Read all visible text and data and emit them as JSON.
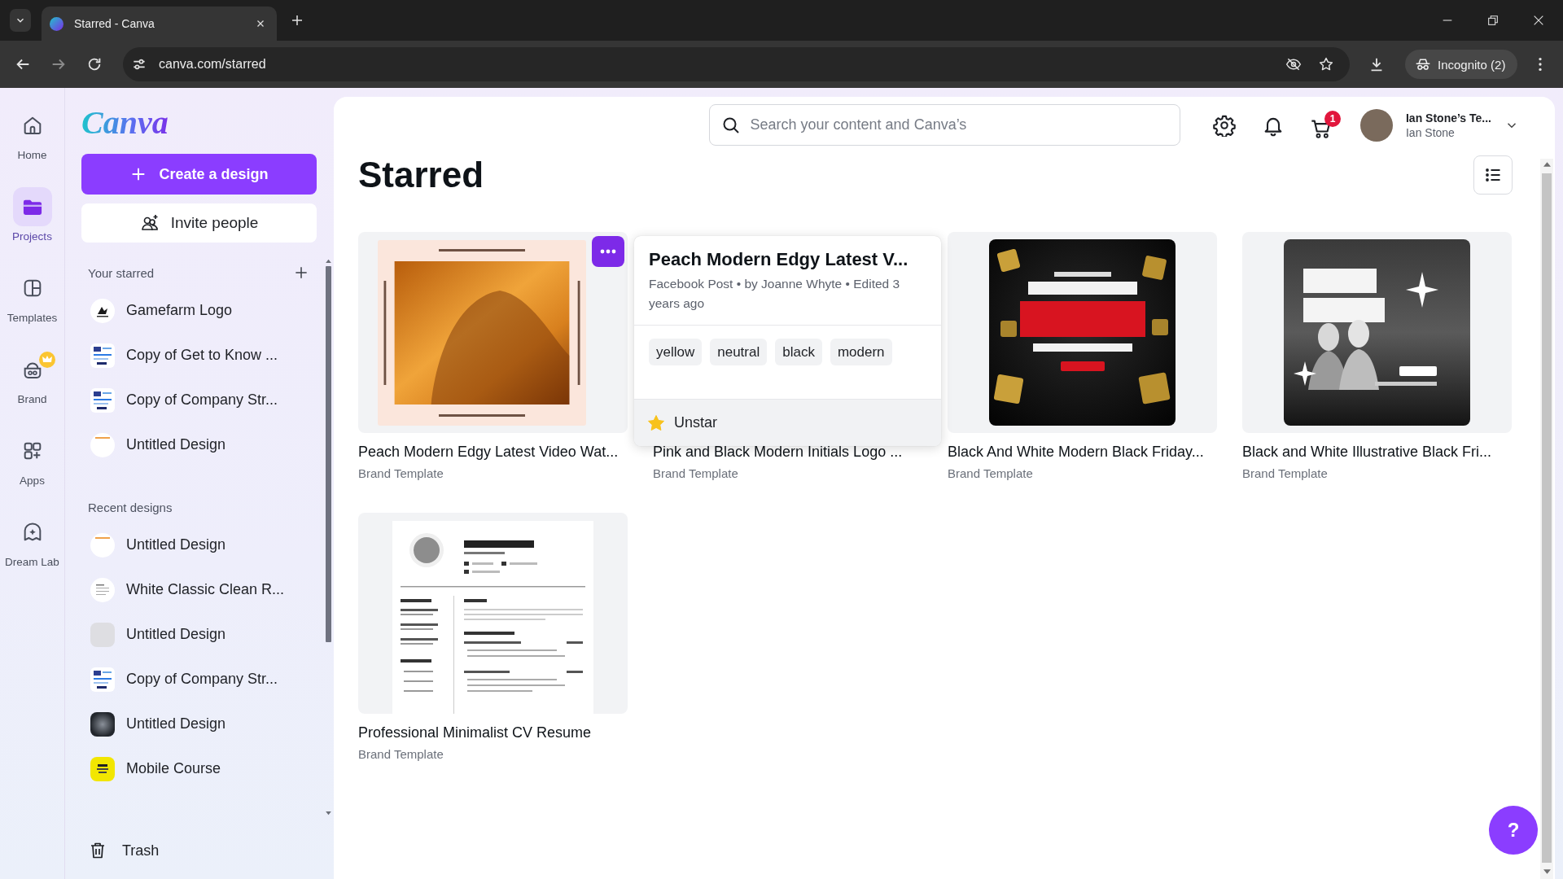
{
  "browser": {
    "tab_title": "Starred - Canva",
    "url": "canva.com/starred",
    "profile": "Incognito (2)"
  },
  "rail": [
    {
      "label": "Home",
      "selected": false,
      "crown_badge": false
    },
    {
      "label": "Projects",
      "selected": true,
      "crown_badge": false
    },
    {
      "label": "Templates",
      "selected": false,
      "crown_badge": false
    },
    {
      "label": "Brand",
      "selected": false,
      "crown_badge": true
    },
    {
      "label": "Apps",
      "selected": false,
      "crown_badge": false
    },
    {
      "label": "Dream Lab",
      "selected": false,
      "crown_badge": false
    }
  ],
  "sidebar": {
    "logo": "Canva",
    "create_button": "Create a design",
    "invite_button": "Invite people",
    "starred_heading": "Your starred",
    "starred": [
      {
        "name": "Gamefarm Logo",
        "kind": "mark"
      },
      {
        "name": "Copy of Get to Know ...",
        "kind": "slides"
      },
      {
        "name": "Copy of Company Str...",
        "kind": "slides"
      },
      {
        "name": "Untitled Design",
        "kind": "plain"
      }
    ],
    "recent_heading": "Recent designs",
    "recent": [
      {
        "name": "Untitled Design",
        "kind": "plain"
      },
      {
        "name": "White Classic Clean R...",
        "kind": "doc"
      },
      {
        "name": "Untitled Design",
        "kind": "grey"
      },
      {
        "name": "Copy of Company Str...",
        "kind": "slides"
      },
      {
        "name": "Untitled Design",
        "kind": "dark"
      },
      {
        "name": "Mobile Course",
        "kind": "yellow"
      }
    ],
    "trash": "Trash"
  },
  "header": {
    "search": {
      "placeholder": "Search your content and Canva’s"
    },
    "cart_count": "1",
    "account": {
      "team": "Ian Stone’s Te...",
      "name": "Ian Stone"
    }
  },
  "page": {
    "title": "Starred",
    "cards": [
      {
        "title": "Peach Modern Edgy Latest Video Wat...",
        "subtitle": "Brand Template",
        "kind": "peach",
        "menu_open": true,
        "menu": {
          "title": "Peach Modern Edgy Latest V...",
          "meta": "Facebook Post • by Joanne Whyte • Edited 3 years ago",
          "tags": [
            "yellow",
            "neutral",
            "black",
            "modern"
          ],
          "action": "Unstar",
          "highlighted": true
        }
      },
      {
        "title": "Pink and Black Modern Initials Logo ...",
        "subtitle": "Brand Template",
        "kind": "covered",
        "menu_open": false
      },
      {
        "title": "Black And White Modern Black Friday...",
        "subtitle": "Brand Template",
        "kind": "sale",
        "menu_open": false
      },
      {
        "title": "Black and White Illustrative Black Fri...",
        "subtitle": "Brand Template",
        "kind": "monochrome",
        "menu_open": false
      },
      {
        "title": "Professional Minimalist CV Resume",
        "subtitle": "Brand Template",
        "kind": "resume",
        "menu_open": false
      }
    ]
  },
  "help_button": "?"
}
